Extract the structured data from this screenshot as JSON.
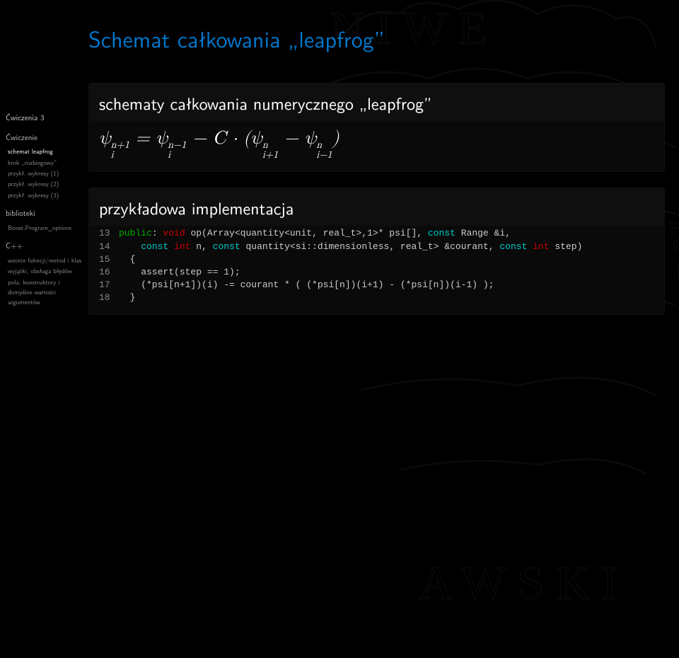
{
  "sidebar": {
    "nav_title": "Ćwiczenia 3",
    "sections": [
      {
        "label": "Ćwiczenie",
        "items": [
          "schemat leapfrog",
          "krok „rozbiegowy”",
          "przykł. wykresy (1)",
          "przykł. wykresy (2)",
          "przykł. wykresy (3)"
        ]
      },
      {
        "label": "biblioteki",
        "items": [
          "Boost.Program_options"
        ]
      },
      {
        "label": "C++",
        "items": [
          "wzorce fukncji/metod i klas",
          "wyjątki, obsługa błędów",
          "pola, konstruktory i domyślne wartości argumentów"
        ]
      }
    ],
    "active": "schemat leapfrog"
  },
  "title": "Schemat całkowania „leapfrog”",
  "box1": {
    "title": "schematy całkowania numerycznego „leapfrog”",
    "formula_plain": "ψ_i^{n+1} = ψ_i^{n−1} − C · (ψ_{i+1}^n − ψ_{i−1}^n)"
  },
  "box2": {
    "title": "przykładowa implementacja",
    "code": [
      {
        "n": "13",
        "tokens": [
          {
            "c": "kw-green",
            "t": "public"
          },
          {
            "t": ": "
          },
          {
            "c": "kw-red",
            "t": "void"
          },
          {
            "t": " op(Array<quantity<unit, real_t>,1>* psi[], "
          },
          {
            "c": "kw-cyan",
            "t": "const"
          },
          {
            "t": " Range &i,"
          }
        ]
      },
      {
        "n": "14",
        "tokens": [
          {
            "t": "    "
          },
          {
            "c": "kw-cyan",
            "t": "const"
          },
          {
            "t": " "
          },
          {
            "c": "kw-red",
            "t": "int"
          },
          {
            "t": " n, "
          },
          {
            "c": "kw-cyan",
            "t": "const"
          },
          {
            "t": " quantity<si::dimensionless, real_t> &courant, "
          },
          {
            "c": "kw-cyan",
            "t": "const"
          },
          {
            "t": " "
          },
          {
            "c": "kw-red",
            "t": "int"
          },
          {
            "t": " step)"
          }
        ]
      },
      {
        "n": "15",
        "tokens": [
          {
            "t": "  {"
          }
        ]
      },
      {
        "n": "16",
        "tokens": [
          {
            "t": "    assert(step == 1);"
          }
        ]
      },
      {
        "n": "17",
        "tokens": [
          {
            "t": "    (*psi[n+1])(i) -= courant * ( (*psi[n])(i+1) - (*psi[n])(i-1) );"
          }
        ]
      },
      {
        "n": "18",
        "tokens": [
          {
            "t": "  }"
          }
        ]
      }
    ]
  }
}
